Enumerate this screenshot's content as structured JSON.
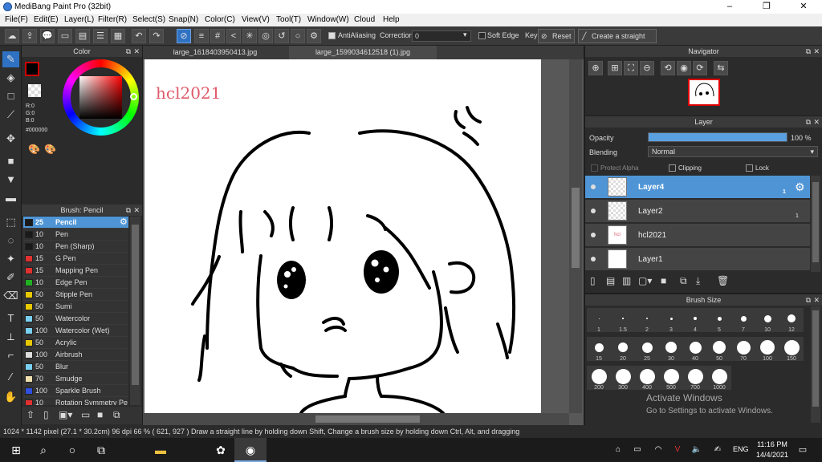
{
  "window": {
    "title": "MediBang Paint Pro (32bit)",
    "minimize": "–",
    "maximize": "❐",
    "close": "✕"
  },
  "menu": [
    "File(F)",
    "Edit(E)",
    "Layer(L)",
    "Filter(R)",
    "Select(S)",
    "Snap(N)",
    "Color(C)",
    "View(V)",
    "Tool(T)",
    "Window(W)",
    "Cloud",
    "Help"
  ],
  "toolbar": {
    "antialiasing": "AntiAliasing",
    "correction_label": "Correction",
    "correction_value": "0",
    "soft_edge": "Soft Edge",
    "key": "Key",
    "reset": "Reset",
    "straight_line": "Create a straight line"
  },
  "color_panel": {
    "title": "Color",
    "r": "R:0",
    "g": "G:0",
    "b": "B:0",
    "hex": "#000000"
  },
  "brush_panel": {
    "title": "Brush: Pencil",
    "brushes": [
      {
        "size": "25",
        "name": "Pencil",
        "color": "#1a1a1a"
      },
      {
        "size": "10",
        "name": "Pen",
        "color": "#1a1a1a"
      },
      {
        "size": "10",
        "name": "Pen (Sharp)",
        "color": "#1a1a1a"
      },
      {
        "size": "15",
        "name": "G Pen",
        "color": "#e03030"
      },
      {
        "size": "15",
        "name": "Mapping Pen",
        "color": "#e03030"
      },
      {
        "size": "10",
        "name": "Edge Pen",
        "color": "#20b020"
      },
      {
        "size": "50",
        "name": "Stipple Pen",
        "color": "#e8c800"
      },
      {
        "size": "50",
        "name": "Sumi",
        "color": "#e8c800"
      },
      {
        "size": "50",
        "name": "Watercolor",
        "color": "#7ad0f0"
      },
      {
        "size": "100",
        "name": "Watercolor (Wet)",
        "color": "#7ad0f0"
      },
      {
        "size": "50",
        "name": "Acrylic",
        "color": "#e8c800"
      },
      {
        "size": "100",
        "name": "Airbrush",
        "color": "#dddddd"
      },
      {
        "size": "50",
        "name": "Blur",
        "color": "#7ad0f0"
      },
      {
        "size": "70",
        "name": "Smudge",
        "color": "#f0e0b0"
      },
      {
        "size": "100",
        "name": "Sparkle Brush",
        "color": "#3050e0"
      },
      {
        "size": "10",
        "name": "Rotation Symmetry Pe",
        "color": "#e03030"
      }
    ]
  },
  "tabs": [
    "large_1618403950413.jpg",
    "large_1599034612518 (1).jpg"
  ],
  "canvas": {
    "signature": "hcl2021"
  },
  "navigator": {
    "title": "Navigator"
  },
  "layer_panel": {
    "title": "Layer",
    "opacity_label": "Opacity",
    "opacity_value": "100 %",
    "opacity": 1.0,
    "blending_label": "Blending",
    "blending_value": "Normal",
    "protect_alpha": "Protect Alpha",
    "clipping": "Clipping",
    "lock": "Lock",
    "layers": [
      {
        "name": "Layer4",
        "num": "1"
      },
      {
        "name": "Layer2",
        "num": "1"
      },
      {
        "name": "hcl2021",
        "num": ""
      },
      {
        "name": "Layer1",
        "num": ""
      }
    ]
  },
  "brush_size_panel": {
    "title": "Brush Size",
    "sizes": [
      "1",
      "1.5",
      "2",
      "3",
      "4",
      "5",
      "7",
      "10",
      "12",
      "15",
      "20",
      "25",
      "30",
      "40",
      "50",
      "70",
      "100",
      "150",
      "200",
      "300",
      "400",
      "500",
      "700",
      "1000"
    ]
  },
  "statusbar": {
    "text": "1024 * 1142 pixel   (27.1 * 30.2cm)   96 dpi   66 %   ( 621, 927 )   Draw a straight line by holding down Shift, Change a brush size by holding down Ctrl, Alt, and dragging"
  },
  "watermark": {
    "line1": "Activate Windows",
    "line2": "Go to Settings to activate Windows."
  },
  "taskbar": {
    "lang": "ENG",
    "time": "11:16 PM",
    "date": "14/4/2021"
  }
}
